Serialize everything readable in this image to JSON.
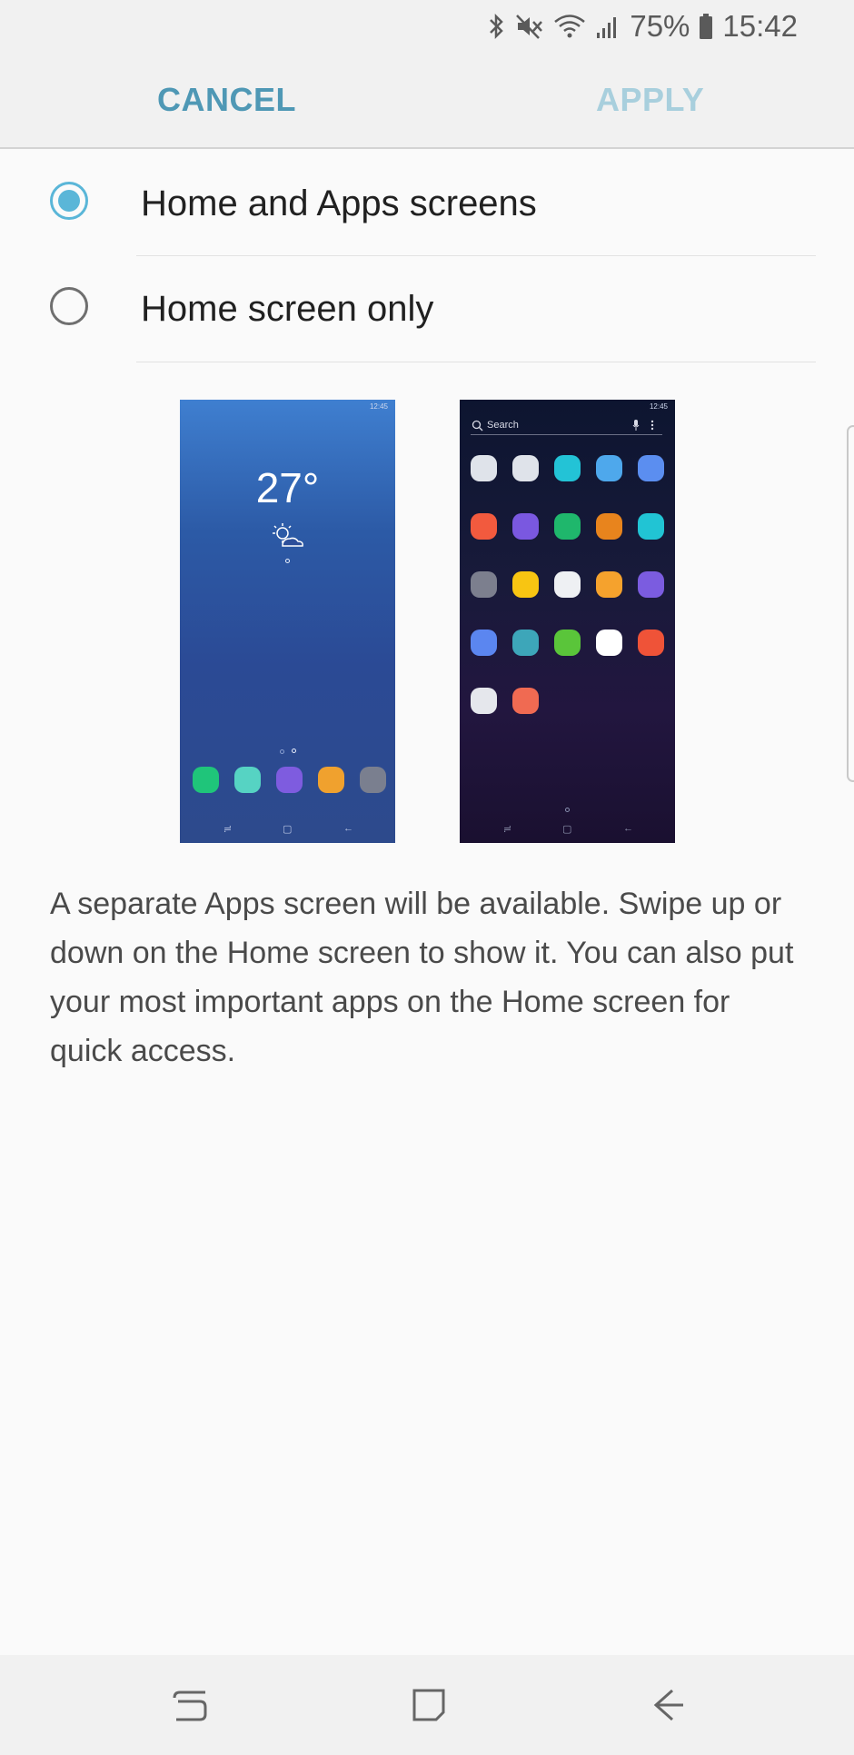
{
  "status_bar": {
    "battery": "75%",
    "time": "15:42",
    "icons": [
      "bluetooth-icon",
      "mute-icon",
      "wifi-icon",
      "signal-icon",
      "battery-icon"
    ]
  },
  "action_bar": {
    "cancel_label": "CANCEL",
    "apply_label": "APPLY",
    "apply_enabled": false
  },
  "options": [
    {
      "label": "Home and Apps screens",
      "selected": true
    },
    {
      "label": "Home screen only",
      "selected": false
    }
  ],
  "previews": {
    "home": {
      "status_time": "12:45",
      "temperature": "27°",
      "dock_colors": [
        "#1fc57a",
        "#56d3c3",
        "#7e5cdf",
        "#f0a12e",
        "#7a7f8f"
      ]
    },
    "apps": {
      "status_time": "12:45",
      "search_label": "Search",
      "icon_colors": [
        "#dfe3ea",
        "#dfe3ea",
        "#23c3d6",
        "#4ea8ec",
        "#5b8ef0",
        "#f25a3e",
        "#7a58e0",
        "#1fb76c",
        "#e8841d",
        "#21c4d4",
        "#7c7f8e",
        "#f8c512",
        "#eef0f3",
        "#f5a22d",
        "#7b5ce0",
        "#5b86f0",
        "#3da6b9",
        "#5ac53a",
        "#ffffff",
        "#ef5338",
        "#e5e7ec",
        "#f06a52"
      ]
    }
  },
  "description": "A separate Apps screen will be available. Swipe up or down on the Home screen to show it. You can also put your most important apps on the Home screen for quick access.",
  "nav_bar": {
    "buttons": [
      "recents-icon",
      "home-icon",
      "back-icon"
    ]
  },
  "colors": {
    "accent": "#5ab6d8",
    "cancel": "#4f98b5",
    "apply_disabled": "#a8cfdd"
  }
}
